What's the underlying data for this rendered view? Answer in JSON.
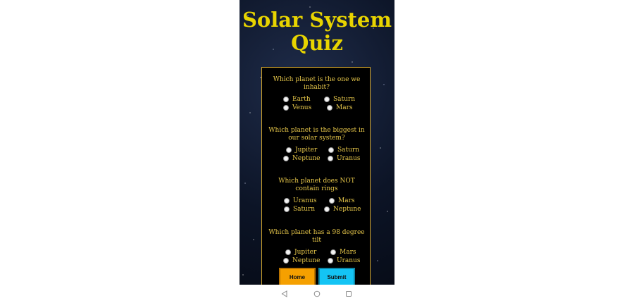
{
  "app": {
    "title": "Solar System Quiz",
    "title_line1": "Solar System",
    "title_line2": "Quiz"
  },
  "colors": {
    "title": "#e8d400",
    "text": "#e8c84a",
    "box_border": "#d4a72c",
    "home_button": "#f5a000",
    "submit_button": "#14c4f4"
  },
  "questions": [
    {
      "text": "Which planet is the one we inhabit?",
      "options": [
        "Earth",
        "Saturn",
        "Venus",
        "Mars"
      ]
    },
    {
      "text": "Which planet is the biggest in our solar system?",
      "options": [
        "Jupiter",
        "Saturn",
        "Neptune",
        "Uranus"
      ]
    },
    {
      "text": "Which planet does NOT contain rings",
      "options": [
        "Uranus",
        "Mars",
        "Saturn",
        "Neptune"
      ]
    },
    {
      "text": "Which planet has a 98 degree tilt",
      "options": [
        "Jupiter",
        "Mars",
        "Neptune",
        "Uranus"
      ]
    }
  ],
  "buttons": {
    "home": "Home",
    "submit": "Submit"
  },
  "navbar": {
    "back_icon": "back-triangle-icon",
    "home_icon": "home-circle-icon",
    "recents_icon": "recents-square-icon"
  }
}
